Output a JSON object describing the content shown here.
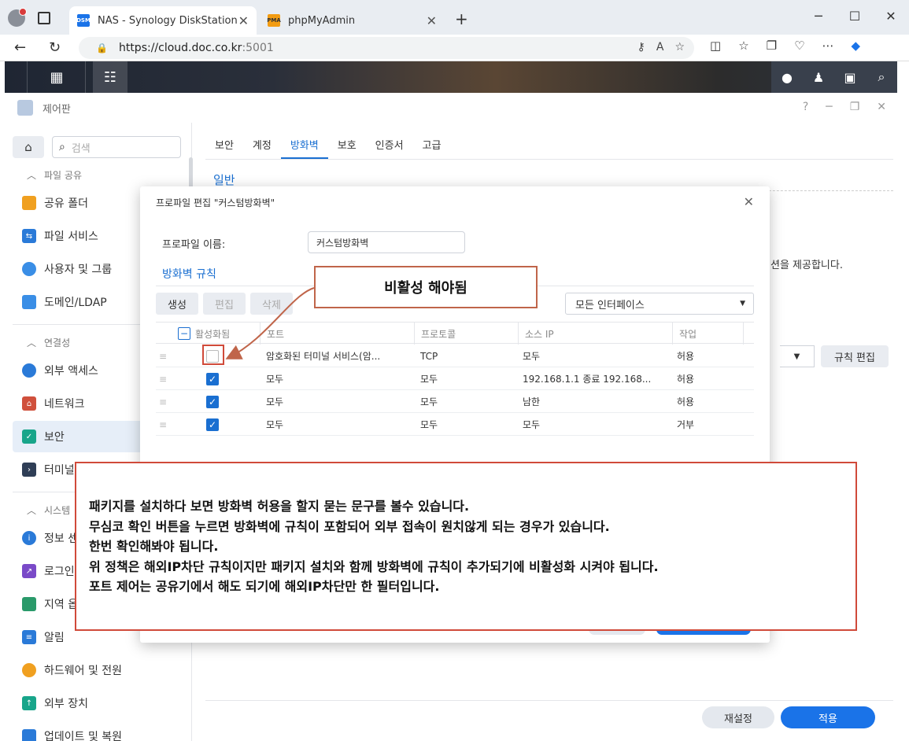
{
  "browser": {
    "tabs": [
      {
        "label": "NAS - Synology DiskStation",
        "favicon": "DSM"
      },
      {
        "label": "phpMyAdmin",
        "favicon": "PMA"
      }
    ],
    "url_host": "https://cloud.doc.co.kr",
    "url_port": ":5001"
  },
  "window": {
    "title": "제어판"
  },
  "sidebar": {
    "search_placeholder": "검색",
    "groups": {
      "file_sharing": "파일 공유",
      "connectivity": "연결성",
      "system": "시스템"
    },
    "items": [
      {
        "label": "공유 폴더",
        "color": "#f0a020"
      },
      {
        "label": "파일 서비스",
        "color": "#2a7ad8"
      },
      {
        "label": "사용자 및 그룹",
        "color": "#3a8ee6"
      },
      {
        "label": "도메인/LDAP",
        "color": "#3a8ee6"
      },
      {
        "label": "외부 액세스",
        "color": "#2a7ad8"
      },
      {
        "label": "네트워크",
        "color": "#d0503c"
      },
      {
        "label": "보안",
        "color": "#18a58a"
      },
      {
        "label": "터미널",
        "color": "#2f3e56"
      },
      {
        "label": "정보 센",
        "color": "#2a7ad8"
      },
      {
        "label": "로그인",
        "color": "#7a4ac8"
      },
      {
        "label": "지역 옵",
        "color": "#2a9a6a"
      },
      {
        "label": "알림",
        "color": "#2a7ad8"
      },
      {
        "label": "하드웨어 및 전원",
        "color": "#f0a020"
      },
      {
        "label": "외부 장치",
        "color": "#18a58a"
      },
      {
        "label": "업데이트 및 복원",
        "color": "#2a7ad8"
      }
    ]
  },
  "main": {
    "tabs": [
      "보안",
      "계정",
      "방화벽",
      "보호",
      "인증서",
      "고급"
    ],
    "active_tab": "방화벽",
    "section_title": "일반",
    "bg_text": "션을 제공합니다.",
    "rule_edit": "규칙 편집",
    "reset": "재설정",
    "apply": "적용"
  },
  "modal": {
    "title": "프로파일 편집 \"커스텀방화벽\"",
    "profile_label": "프로파일 이름:",
    "profile_value": "커스텀방화벽",
    "rules_title": "방화벽 규칙",
    "buttons": {
      "create": "생성",
      "edit": "편집",
      "delete": "삭제"
    },
    "interface": "모든 인터페이스",
    "columns": [
      "활성화됨",
      "포트",
      "프로토콜",
      "소스 IP",
      "작업"
    ],
    "rows": [
      {
        "enabled": false,
        "port": "암호화된 터미널 서비스(암...",
        "protocol": "TCP",
        "source": "모두",
        "action": "허용"
      },
      {
        "enabled": true,
        "port": "모두",
        "protocol": "모두",
        "source": "192.168.1.1 종료 192.168...",
        "action": "허용"
      },
      {
        "enabled": true,
        "port": "모두",
        "protocol": "모두",
        "source": "남한",
        "action": "허용"
      },
      {
        "enabled": true,
        "port": "모두",
        "protocol": "모두",
        "source": "모두",
        "action": "거부"
      }
    ]
  },
  "annotations": {
    "callout": "비활성 해야됨",
    "note_lines": [
      "패키지를 설치하다 보면 방화벽 허용을 할지 묻는 문구를 볼수 있습니다.",
      "무심코 확인 버튼을 누르면 방화벽에 규칙이 포함되어 외부 접속이 원치않게 되는 경우가 있습니다.",
      "한번 확인해봐야 됩니다.",
      "위 정책은 해외IP차단 규칙이지만 패키지 설치와 함께 방화벽에 규칙이 추가되기에 비활성화 시켜야 됩니다.",
      "포트 제어는 공유기에서 해도 되기에 해외IP차단만 한 필터입니다."
    ]
  }
}
